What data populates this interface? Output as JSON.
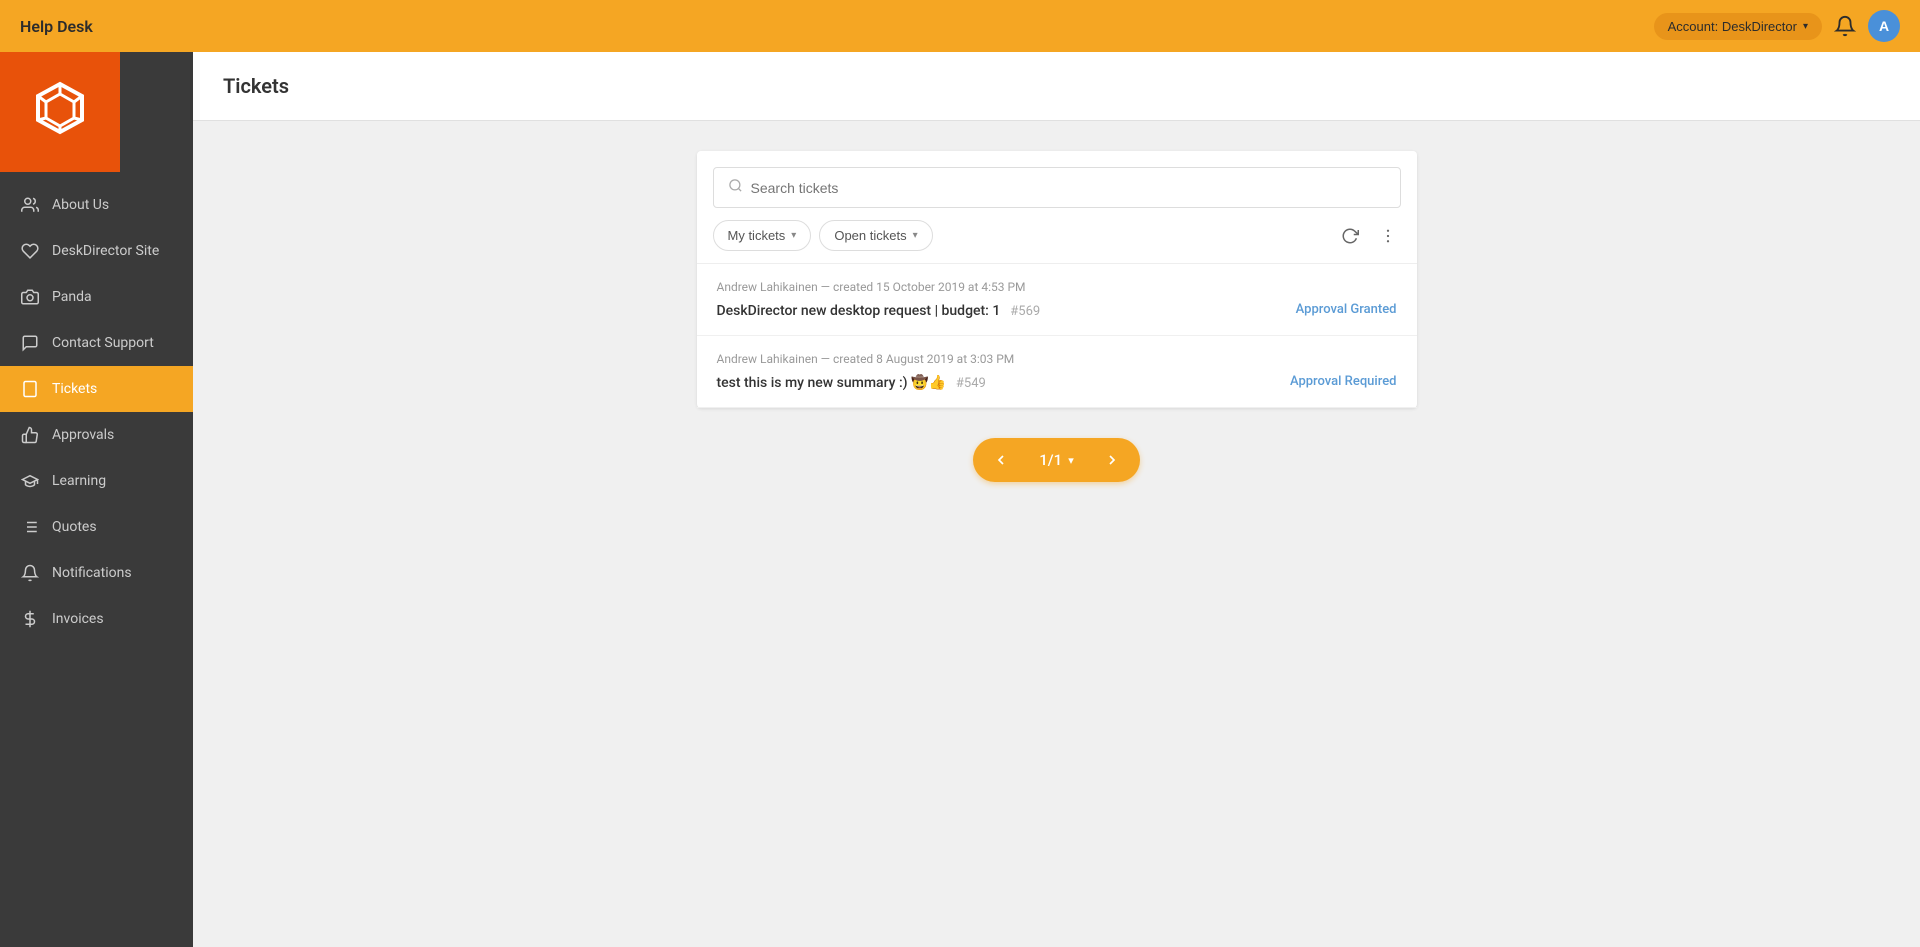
{
  "app": {
    "title": "Help Desk"
  },
  "header": {
    "account_label": "Account: DeskDirector",
    "avatar_letter": "A"
  },
  "sidebar": {
    "items": [
      {
        "id": "about-us",
        "label": "About Us",
        "icon": "people"
      },
      {
        "id": "deskdirector-site",
        "label": "DeskDirector Site",
        "icon": "heart"
      },
      {
        "id": "panda",
        "label": "Panda",
        "icon": "camera"
      },
      {
        "id": "contact-support",
        "label": "Contact Support",
        "icon": "chat"
      },
      {
        "id": "tickets",
        "label": "Tickets",
        "icon": "tablet",
        "active": true
      },
      {
        "id": "approvals",
        "label": "Approvals",
        "icon": "thumbsup"
      },
      {
        "id": "learning",
        "label": "Learning",
        "icon": "graduation"
      },
      {
        "id": "quotes",
        "label": "Quotes",
        "icon": "list"
      },
      {
        "id": "notifications",
        "label": "Notifications",
        "icon": "bell"
      },
      {
        "id": "invoices",
        "label": "Invoices",
        "icon": "dollar"
      }
    ]
  },
  "page": {
    "title": "Tickets"
  },
  "search": {
    "placeholder": "Search tickets"
  },
  "filters": {
    "my_tickets": "My tickets",
    "open_tickets": "Open tickets"
  },
  "tickets": [
    {
      "meta": "Andrew Lahikainen — created 15 October 2019 at 4:53 PM",
      "summary": "DeskDirector new desktop request | budget: 1",
      "number": "#569",
      "status": "Approval Granted",
      "emojis": ""
    },
    {
      "meta": "Andrew Lahikainen — created 8 August 2019 at 3:03 PM",
      "summary": "test this is my new summary :) 🤠👍",
      "number": "#549",
      "status": "Approval Required",
      "emojis": ""
    }
  ],
  "pagination": {
    "current": "1/1"
  }
}
